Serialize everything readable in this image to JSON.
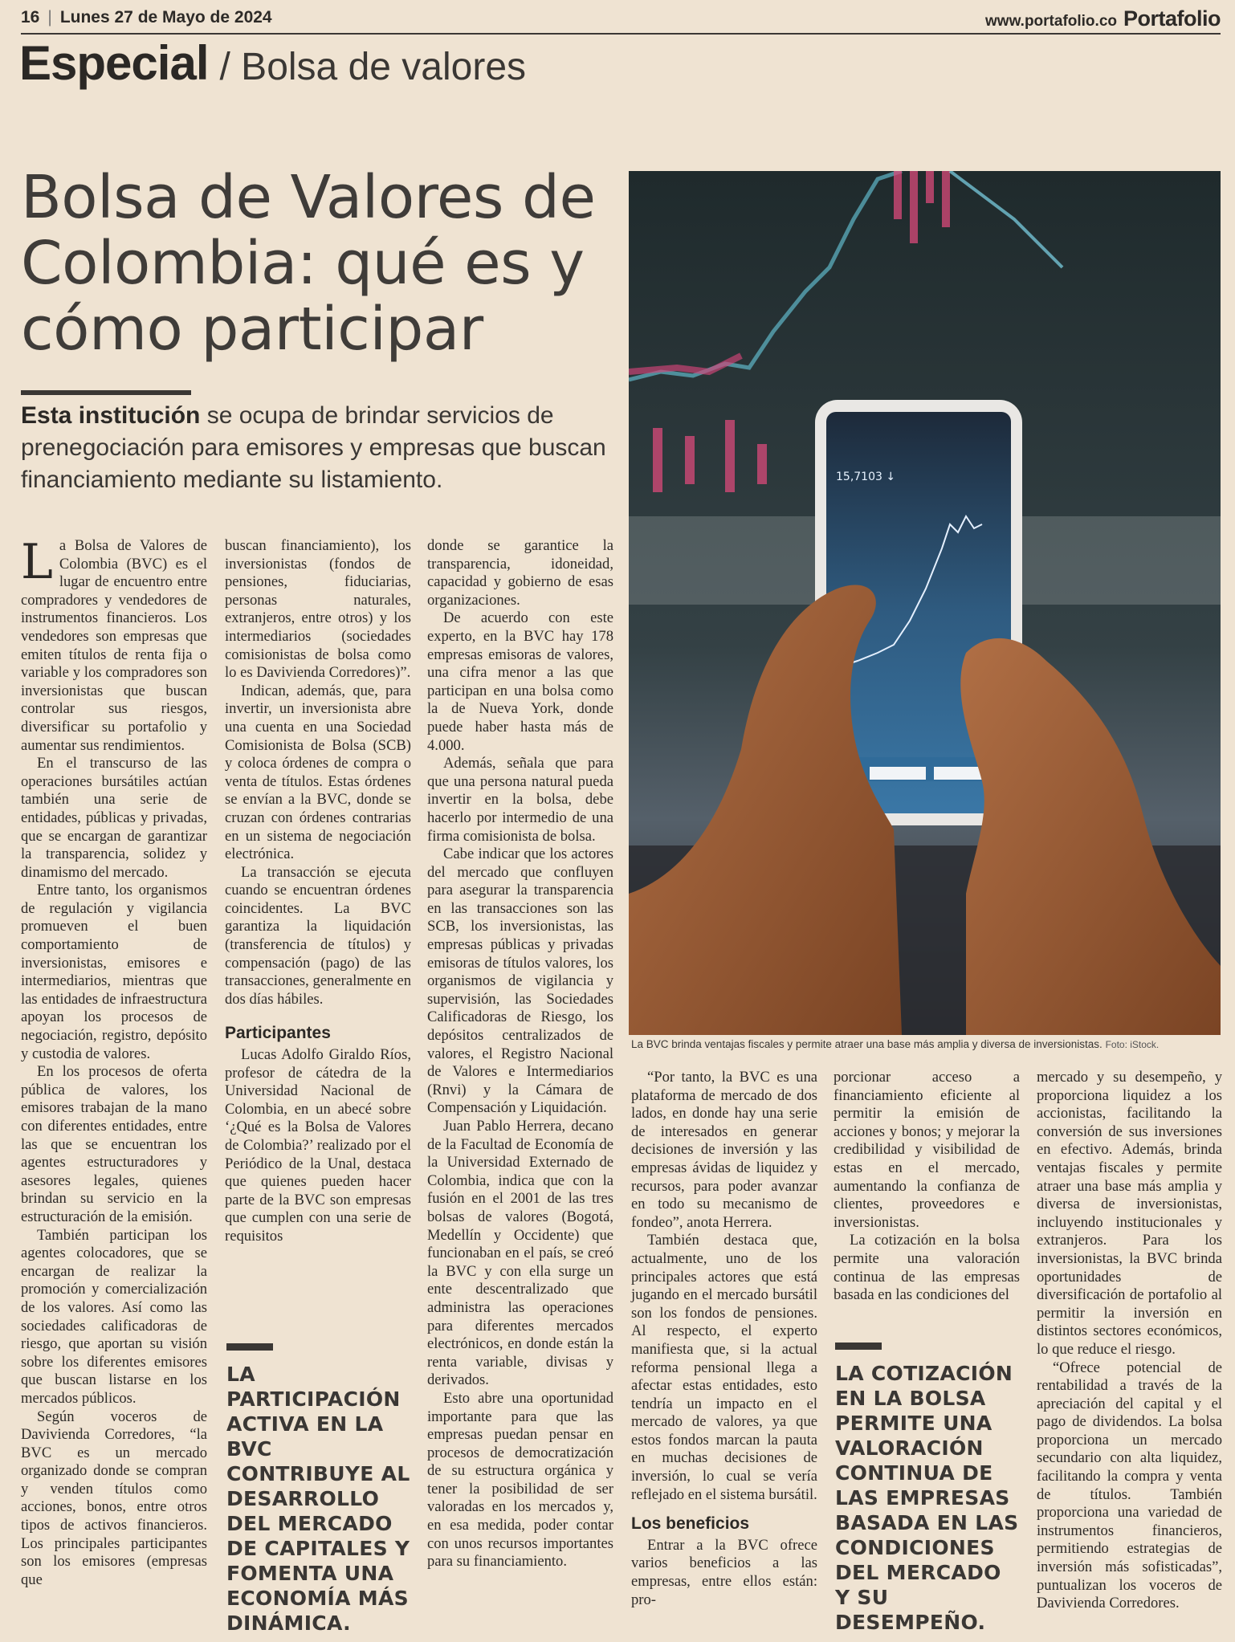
{
  "header": {
    "page_number": "16",
    "date": "Lunes 27 de Mayo de 2024",
    "url": "www.portafolio.co",
    "brand": "Portafolio"
  },
  "section": {
    "main": "Especial",
    "sub": "/ Bolsa de valores"
  },
  "headline": "Bolsa de Valores de Colombia: qué es y cómo participar",
  "deck": {
    "lead": "Esta institución",
    "rest": " se ocupa de brindar servicios de prenegociación para emisores y empresas que buscan financiamiento mediante su listamiento."
  },
  "photo": {
    "caption": "La BVC brinda ventajas fiscales y permite atraer una base más amplia y diversa de inversionistas.",
    "credit": "Foto: iStock.",
    "phone_price": "15,7103 ↓"
  },
  "pull_quotes": {
    "q1": "La participación activa en la BVC contribuye al desarrollo del mercado de capitales y fomenta una economía más dinámica.",
    "q2": "La cotización en la bolsa permite una valoración continua de las empresas basada en las condiciones del mercado y su desempeño."
  },
  "body": {
    "dropcap": "L",
    "c1": [
      "a Bolsa de Valores de Colombia (BVC) es el lugar de encuentro entre compradores y vendedores de instrumentos financieros. Los vendedores son empresas que emiten títulos de renta fija o variable y los compradores son inversionistas que buscan controlar sus riesgos, diversificar su portafolio y aumentar sus rendimientos.",
      "En el transcurso de las operaciones bursátiles actúan también una serie de entidades, públicas y privadas, que se encargan de garantizar la transparencia, solidez y dinamismo del mercado.",
      "Entre tanto, los organismos de regulación y vigilancia promueven el buen comportamiento de inversionistas, emisores e intermediarios, mientras que las entidades de infraestructura apoyan los procesos de negociación, registro, depósito y custodia de valores.",
      "En los procesos de oferta pública de valores, los emisores trabajan de la mano con diferentes entidades, entre las que se encuentran los agentes estructuradores y asesores legales, quienes brindan su servicio en la estructuración de la emisión.",
      "También participan los agentes colocadores, que se encargan de realizar la promoción y comercialización de los valores. Así como las sociedades calificadoras de riesgo, que aportan su visión sobre los diferentes emisores que buscan listarse en los mercados públicos.",
      "Según voceros de Davivienda Corredores, “la BVC es un mercado organizado donde se compran y venden títulos como acciones, bonos, entre otros tipos de activos financieros. Los principales participantes son los emisores (empresas que"
    ],
    "c2a": [
      "buscan financiamiento), los inversionistas (fondos de pensiones, fiduciarias, personas naturales, extranjeros, entre otros) y los intermediarios (sociedades comisionistas de bolsa como lo es Davivienda Corredores)”.",
      "Indican, además, que, para invertir, un inversionista abre una cuenta en una Sociedad Comisionista de Bolsa (SCB) y coloca órdenes de compra o venta de títulos. Estas órdenes se envían a la BVC, donde se cruzan con órdenes contrarias en un sistema de negociación electrónica.",
      "La transacción se ejecuta cuando se encuentran órdenes coincidentes. La BVC garantiza la liquidación (transferencia de títulos) y compensación (pago) de las transacciones, generalmente en dos días hábiles."
    ],
    "participantes_title": "Participantes",
    "c2b": [
      "Lucas Adolfo Giraldo Ríos, profesor de cátedra de la Universidad Nacional de Colombia, en un abecé sobre ‘¿Qué es la Bolsa de Valores de Colombia?’ realizado por el Periódico de la Unal, destaca que quienes pueden hacer parte de la BVC son empresas que cumplen con una serie de requisitos"
    ],
    "c3": [
      "donde se garantice la transparencia, idoneidad, capacidad y gobierno de esas organizaciones.",
      "De acuerdo con este experto, en la BVC hay 178 empresas emisoras de valores, una cifra menor a las que participan en una bolsa como la de Nueva York, donde puede haber hasta más de 4.000.",
      "Además, señala que para que una persona natural pueda invertir en la bolsa, debe hacerlo por intermedio de una firma comisionista de bolsa.",
      "Cabe indicar que los actores del mercado que confluyen para asegurar la transparencia en las transacciones son las SCB, los inversionistas, las empresas públicas y privadas emisoras de títulos valores, los organismos de vigilancia y supervisión, las Sociedades Calificadoras de Riesgo, los depósitos centralizados de valores, el Registro Nacional de Valores e Intermediarios (Rnvi) y la Cámara de Compensación y Liquidación.",
      "Juan Pablo Herrera, decano de la Facultad de Economía de la Universidad Externado de Colombia, indica que con la fusión en el 2001 de las tres bolsas de valores (Bogotá, Medellín y Occidente) que funcionaban en el país, se creó la BVC y con ella surge un ente descentralizado que administra las operaciones para diferentes mercados electrónicos, en donde están la renta variable, divisas y derivados.",
      "Esto abre una oportunidad importante para que las empresas puedan pensar en procesos de democratización de su estructura orgánica y tener la posibilidad de ser valoradas en los mercados y, en esa medida, poder contar con unos recursos importantes para su financiamiento."
    ],
    "c4a": [
      "“Por tanto, la BVC es una plataforma de mercado de dos lados, en donde hay una serie de interesados en generar decisiones de inversión y las empresas ávidas de liquidez y recursos, para poder avanzar en todo su mecanismo de fondeo”, anota Herrera.",
      "También destaca que, actualmente, uno de los principales actores que está jugando en el mercado bursátil son los fondos de pensiones. Al respecto, el experto manifiesta que, si la actual reforma pensional llega a afectar estas entidades, esto tendría un impacto en el mercado de valores, ya que estos fondos marcan la pauta en muchas decisiones de inversión, lo cual se vería reflejado en el sistema bursátil."
    ],
    "beneficios_title": "Los beneficios",
    "c4b": [
      "Entrar a la BVC ofrece varios beneficios a las empresas, entre ellos están: pro-"
    ],
    "c5": [
      "porcionar acceso a financiamiento eficiente al permitir la emisión de acciones y bonos; y mejorar la credibilidad y visibilidad de estas en el mercado, aumentando la confianza de clientes, proveedores e inversionistas.",
      "La cotización en la bolsa permite una valoración continua de las empresas basada en las condiciones del"
    ],
    "c6": [
      "mercado y su desempeño, y proporciona liquidez a los accionistas, facilitando la conversión de sus inversiones en efectivo. Además, brinda ventajas fiscales y permite atraer una base más amplia y diversa de inversionistas, incluyendo institucionales y extranjeros. Para los inversionistas, la BVC brinda oportunidades de diversificación de portafolio al permitir la inversión en distintos sectores económicos, lo que reduce el riesgo.",
      "“Ofrece potencial de rentabilidad a través de la apreciación del capital y el pago de dividendos. La bolsa proporciona un mercado secundario con alta liquidez, facilitando la compra y venta de títulos. También proporciona una variedad de instrumentos financieros, permitiendo estrategias de inversión más sofisticadas”, puntualizan los voceros de Davivienda Corredores."
    ]
  }
}
